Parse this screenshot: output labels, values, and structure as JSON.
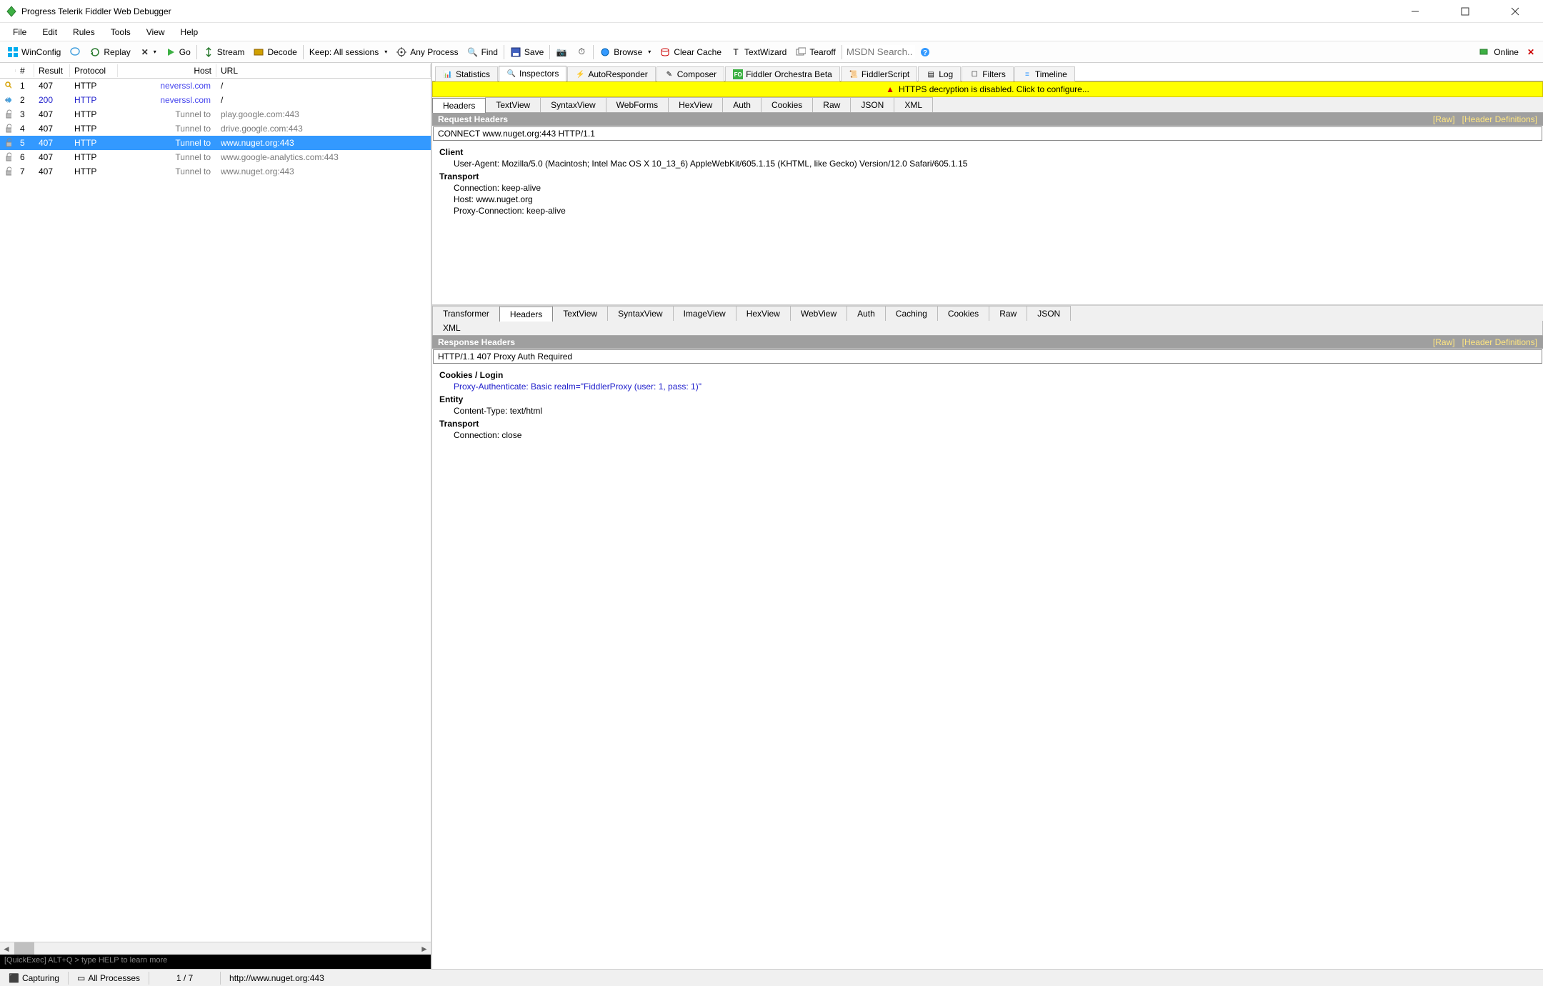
{
  "window": {
    "title": "Progress Telerik Fiddler Web Debugger"
  },
  "menu": {
    "file": "File",
    "edit": "Edit",
    "rules": "Rules",
    "tools": "Tools",
    "view": "View",
    "help": "Help"
  },
  "toolbar": {
    "winconfig": "WinConfig",
    "replay": "Replay",
    "go": "Go",
    "stream": "Stream",
    "decode": "Decode",
    "keep": "Keep: All sessions",
    "anyprocess": "Any Process",
    "find": "Find",
    "save": "Save",
    "browse": "Browse",
    "clearcache": "Clear Cache",
    "textwizard": "TextWizard",
    "tearoff": "Tearoff",
    "search_ph": "MSDN Search...",
    "online": "Online"
  },
  "columns": {
    "num": "#",
    "result": "Result",
    "protocol": "Protocol",
    "host": "Host",
    "url": "URL"
  },
  "sessions": [
    {
      "n": "1",
      "res": "407",
      "proto": "HTTP",
      "host": "neverssl.com",
      "url": "/",
      "hostcls": "host-blue",
      "ico": "key"
    },
    {
      "n": "2",
      "res": "200",
      "proto": "HTTP",
      "host": "neverssl.com",
      "url": "/",
      "hostcls": "host-blue",
      "ico": "diamond",
      "rescolor": "#2020cc",
      "protocolor": "#2020cc"
    },
    {
      "n": "3",
      "res": "407",
      "proto": "HTTP",
      "host": "Tunnel to",
      "url": "play.google.com:443",
      "hostcls": "host-gray",
      "ico": "lock",
      "urlcolor": "#7a7a7a"
    },
    {
      "n": "4",
      "res": "407",
      "proto": "HTTP",
      "host": "Tunnel to",
      "url": "drive.google.com:443",
      "hostcls": "host-gray",
      "ico": "lock",
      "urlcolor": "#7a7a7a"
    },
    {
      "n": "5",
      "res": "407",
      "proto": "HTTP",
      "host": "Tunnel to",
      "url": "www.nuget.org:443",
      "hostcls": "host-gray",
      "ico": "lock",
      "sel": true
    },
    {
      "n": "6",
      "res": "407",
      "proto": "HTTP",
      "host": "Tunnel to",
      "url": "www.google-analytics.com:443",
      "hostcls": "host-gray",
      "ico": "lock",
      "urlcolor": "#7a7a7a"
    },
    {
      "n": "7",
      "res": "407",
      "proto": "HTTP",
      "host": "Tunnel to",
      "url": "www.nuget.org:443",
      "hostcls": "host-gray",
      "ico": "lock",
      "urlcolor": "#7a7a7a"
    }
  ],
  "quickexec": "[QuickExec] ALT+Q > type HELP to learn more",
  "righttabs": {
    "statistics": "Statistics",
    "inspectors": "Inspectors",
    "autoresponder": "AutoResponder",
    "composer": "Composer",
    "orchestra": "Fiddler Orchestra Beta",
    "fiddlerscript": "FiddlerScript",
    "log": "Log",
    "filters": "Filters",
    "timeline": "Timeline"
  },
  "warn": "HTTPS decryption is disabled. Click to configure...",
  "reqtabs": {
    "headers": "Headers",
    "textview": "TextView",
    "syntaxview": "SyntaxView",
    "webforms": "WebForms",
    "hexview": "HexView",
    "auth": "Auth",
    "cookies": "Cookies",
    "raw": "Raw",
    "json": "JSON",
    "xml": "XML"
  },
  "request": {
    "title": "Request Headers",
    "raw_link": "[Raw]",
    "defs_link": "[Header Definitions]",
    "line": "CONNECT www.nuget.org:443 HTTP/1.1",
    "client": "Client",
    "ua": "User-Agent: Mozilla/5.0 (Macintosh; Intel Mac OS X 10_13_6) AppleWebKit/605.1.15 (KHTML, like Gecko) Version/12.0 Safari/605.1.15",
    "transport": "Transport",
    "conn": "Connection: keep-alive",
    "host": "Host: www.nuget.org",
    "proxy": "Proxy-Connection: keep-alive"
  },
  "resptabs": {
    "transformer": "Transformer",
    "headers": "Headers",
    "textview": "TextView",
    "syntaxview": "SyntaxView",
    "imageview": "ImageView",
    "hexview": "HexView",
    "webview": "WebView",
    "auth": "Auth",
    "caching": "Caching",
    "cookies": "Cookies",
    "raw": "Raw",
    "json": "JSON",
    "xml": "XML"
  },
  "response": {
    "title": "Response Headers",
    "raw_link": "[Raw]",
    "defs_link": "[Header Definitions]",
    "line": "HTTP/1.1 407 Proxy Auth Required",
    "cookies": "Cookies / Login",
    "proxyauth": "Proxy-Authenticate: Basic realm=\"FiddlerProxy (user: 1, pass: 1)\"",
    "entity": "Entity",
    "ctype": "Content-Type: text/html",
    "transport": "Transport",
    "conn": "Connection: close"
  },
  "status": {
    "capturing": "Capturing",
    "allproc": "All Processes",
    "count": "1 / 7",
    "url": "http://www.nuget.org:443"
  }
}
